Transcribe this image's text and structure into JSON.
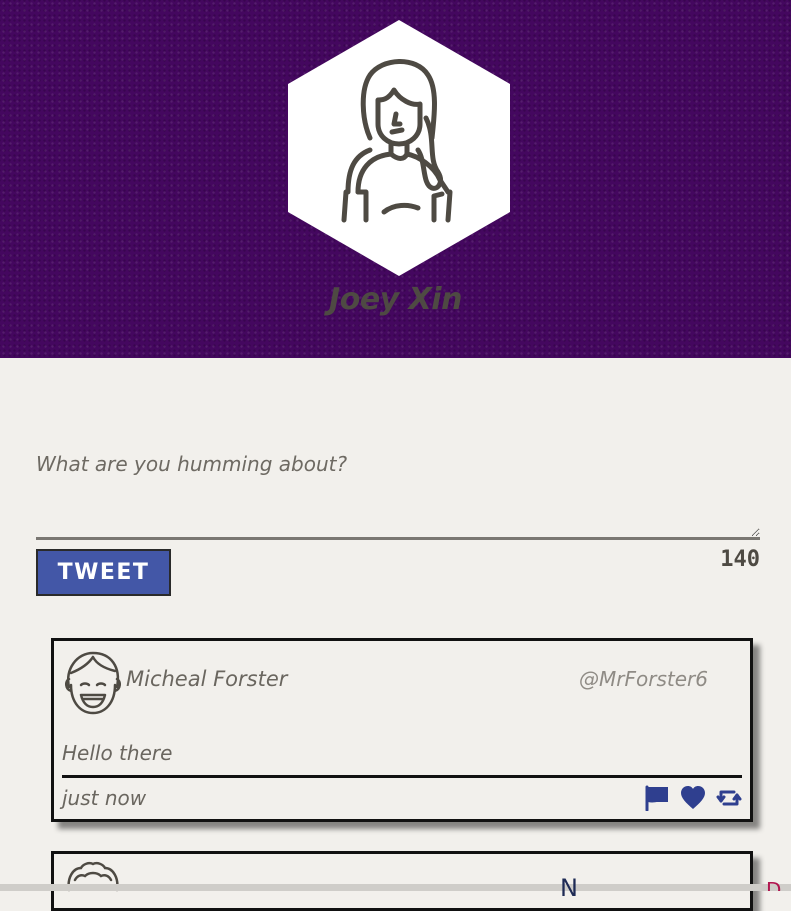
{
  "profile": {
    "name": "Joey Xin",
    "avatar_icon": "woman-avatar-icon",
    "header_color": "#44075f"
  },
  "compose": {
    "placeholder": "What are you humming about?",
    "value": "",
    "tweet_button_label": "TWEET",
    "char_count": "140",
    "button_color": "#4357a7"
  },
  "tweets": [
    {
      "author": "Micheal Forster",
      "handle": "@MrForster6",
      "text": "Hello there",
      "time": "just now",
      "avatar_icon": "smiling-man-avatar-icon",
      "actions": [
        "flag-icon",
        "heart-icon",
        "retweet-icon"
      ],
      "action_color": "#2f3f8f"
    }
  ],
  "footer": {
    "partial_text": "N",
    "partial_red_text": "D"
  }
}
